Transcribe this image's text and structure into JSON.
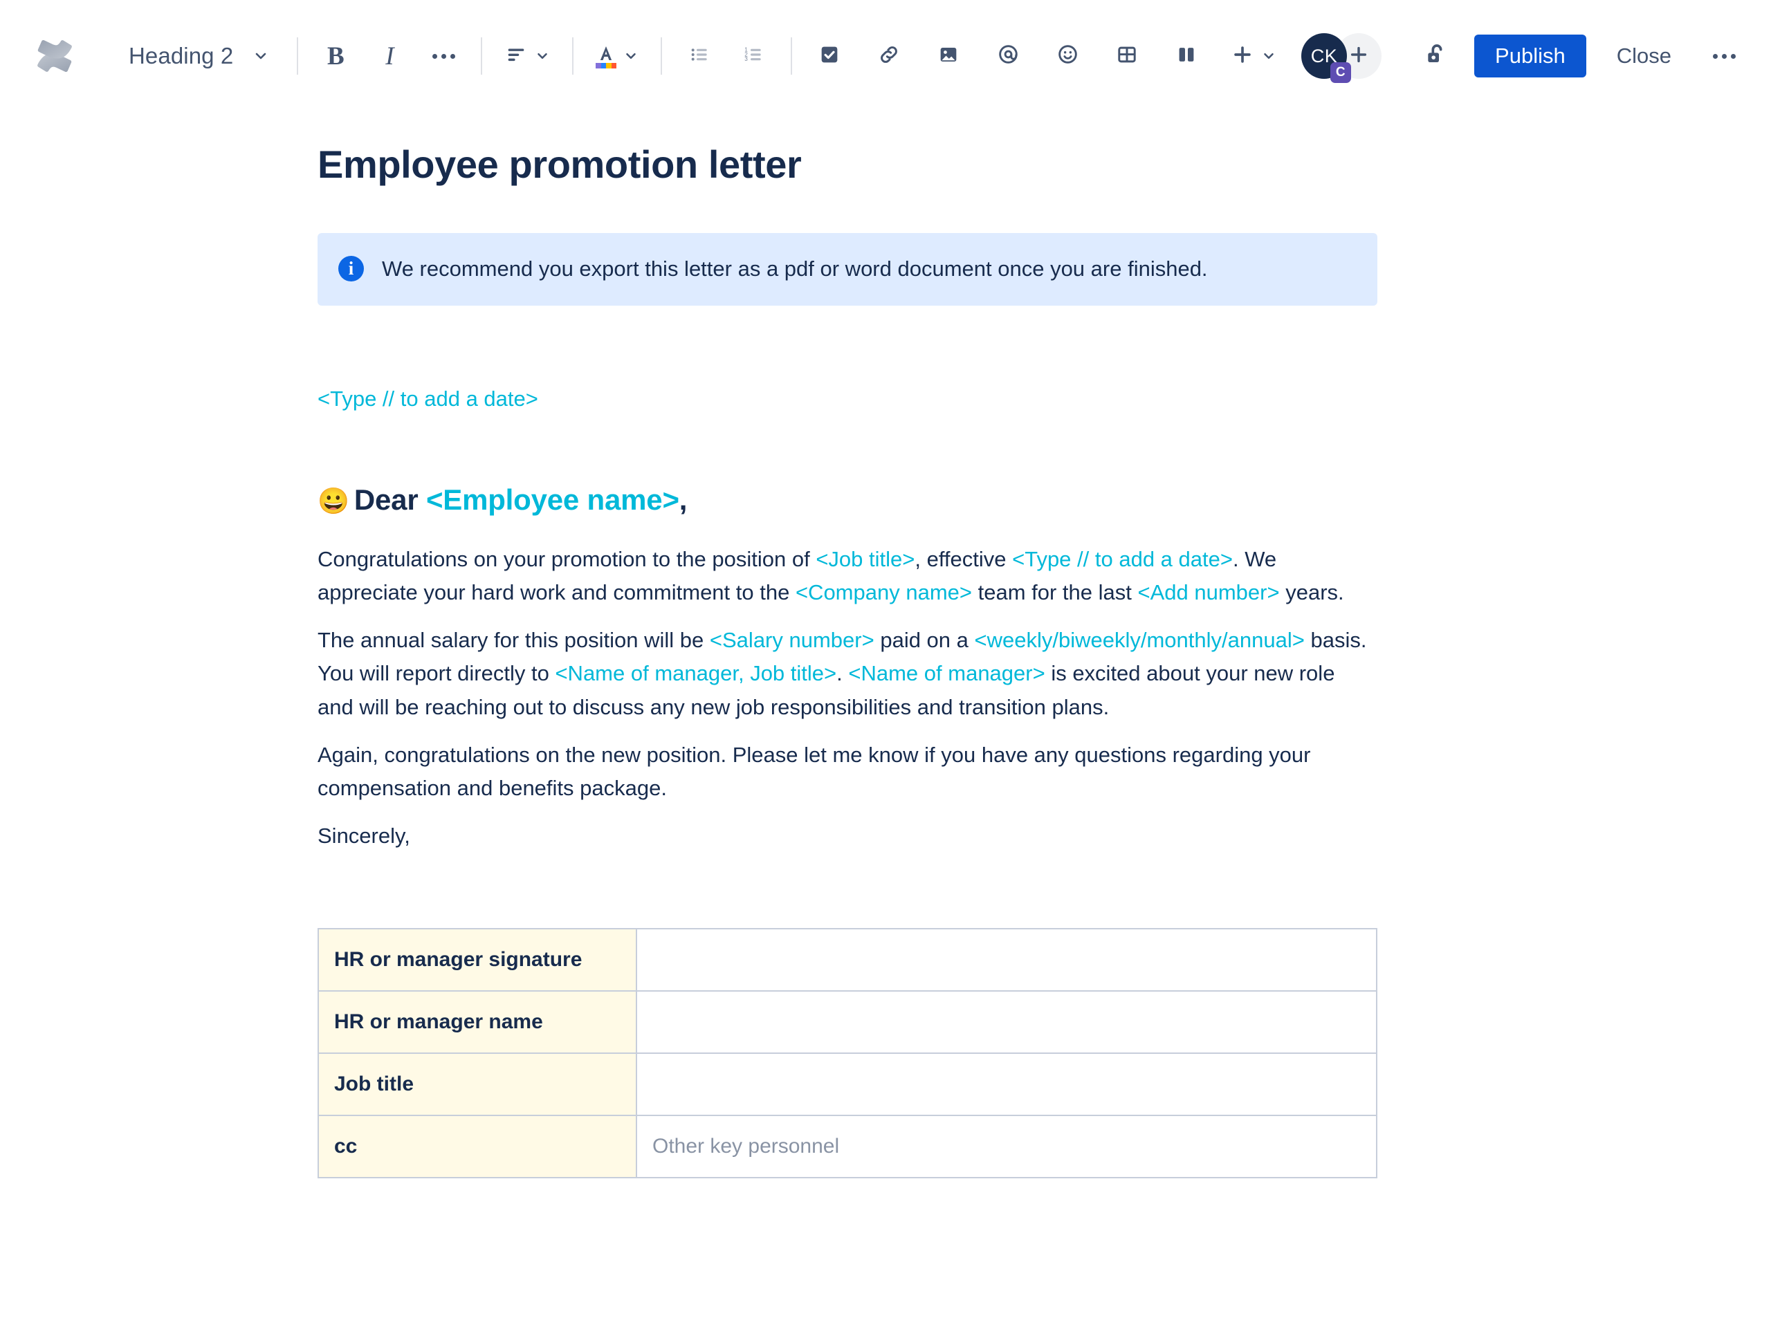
{
  "app": {
    "logo_icon": "confluence-logo-icon"
  },
  "toolbar": {
    "style_dropdown": {
      "label": "Heading 2",
      "chevron_icon": "chevron-down-icon"
    },
    "buttons": [
      {
        "name": "bold-button",
        "label": "B",
        "icon": "bold-icon"
      },
      {
        "name": "italic-button",
        "label": "I",
        "icon": "italic-icon"
      },
      {
        "name": "more-formatting-button",
        "icon": "ellipsis-icon"
      },
      {
        "name": "text-align-button",
        "icon": "align-left-icon"
      },
      {
        "name": "text-color-button",
        "icon": "text-color-icon"
      },
      {
        "name": "bullet-list-button",
        "icon": "bullet-list-icon"
      },
      {
        "name": "numbered-list-button",
        "icon": "numbered-list-icon"
      },
      {
        "name": "action-item-button",
        "icon": "checkbox-icon"
      },
      {
        "name": "link-button",
        "icon": "link-icon"
      },
      {
        "name": "image-button",
        "icon": "image-icon"
      },
      {
        "name": "mention-button",
        "icon": "at-mention-icon"
      },
      {
        "name": "emoji-button",
        "icon": "emoji-icon"
      },
      {
        "name": "table-button",
        "icon": "table-icon"
      },
      {
        "name": "layout-button",
        "icon": "columns-layout-icon"
      },
      {
        "name": "insert-button",
        "icon": "plus-icon"
      }
    ],
    "collaborators": {
      "avatar_initials": "CK",
      "avatar_badge": "C",
      "add_icon": "plus-icon"
    },
    "restrictions_icon": "unlock-icon",
    "publish_label": "Publish",
    "close_label": "Close",
    "more_icon": "ellipsis-icon",
    "colors": {
      "publish_button": "#0C56D0",
      "avatar_background": "#172B4D",
      "avatar_badge": "#5E4DB2",
      "icon": "#44546F"
    }
  },
  "document": {
    "title": "Employee promotion letter",
    "info_panel": {
      "icon": "info-icon",
      "text": "We recommend you export this letter as a pdf or word document once you are finished.",
      "background": "#DEEBFF",
      "icon_color": "#0C66E4"
    },
    "date_placeholder": "<Type // to add a date>",
    "salutation": {
      "emoji": "😀",
      "prefix": "Dear ",
      "placeholder": "<Employee name>",
      "suffix": ","
    },
    "placeholder_color": "#00B8D9",
    "paragraphs": [
      {
        "segments": [
          {
            "t": "Congratulations on your promotion to the position of ",
            "ph": false
          },
          {
            "t": "<Job title>",
            "ph": true
          },
          {
            "t": ", effective ",
            "ph": false
          },
          {
            "t": "<Type // to add a date>",
            "ph": true
          },
          {
            "t": ". We appreciate your hard work and commitment to the ",
            "ph": false
          },
          {
            "t": "<Company name>",
            "ph": true
          },
          {
            "t": " team for the last ",
            "ph": false
          },
          {
            "t": "<Add number>",
            "ph": true
          },
          {
            "t": " years.",
            "ph": false
          }
        ]
      },
      {
        "segments": [
          {
            "t": "The annual salary for this position will be ",
            "ph": false
          },
          {
            "t": "<Salary number>",
            "ph": true
          },
          {
            "t": " paid on a ",
            "ph": false
          },
          {
            "t": "<weekly/biweekly/monthly/annual>",
            "ph": true
          },
          {
            "t": " basis. You will report directly to ",
            "ph": false
          },
          {
            "t": "<Name of manager, Job title>",
            "ph": true
          },
          {
            "t": ". ",
            "ph": false
          },
          {
            "t": "<Name of manager>",
            "ph": true
          },
          {
            "t": " is excited about your new role and will be reaching out to discuss any new job responsibilities and transition plans.",
            "ph": false
          }
        ]
      },
      {
        "segments": [
          {
            "t": "Again, congratulations on the new position. Please let me know if you have any questions regarding your compensation and benefits package.",
            "ph": false
          }
        ]
      },
      {
        "segments": [
          {
            "t": "Sincerely,",
            "ph": false
          }
        ]
      }
    ],
    "table": {
      "header_background": "#FFFAE6",
      "border_color": "#C7CEDB",
      "rows": [
        {
          "label": "HR or manager signature",
          "value": "",
          "value_placeholder": ""
        },
        {
          "label": "HR or manager name",
          "value": "",
          "value_placeholder": ""
        },
        {
          "label": "Job title",
          "value": "",
          "value_placeholder": ""
        },
        {
          "label": "cc",
          "value": "",
          "value_placeholder": "Other key personnel"
        }
      ]
    }
  }
}
